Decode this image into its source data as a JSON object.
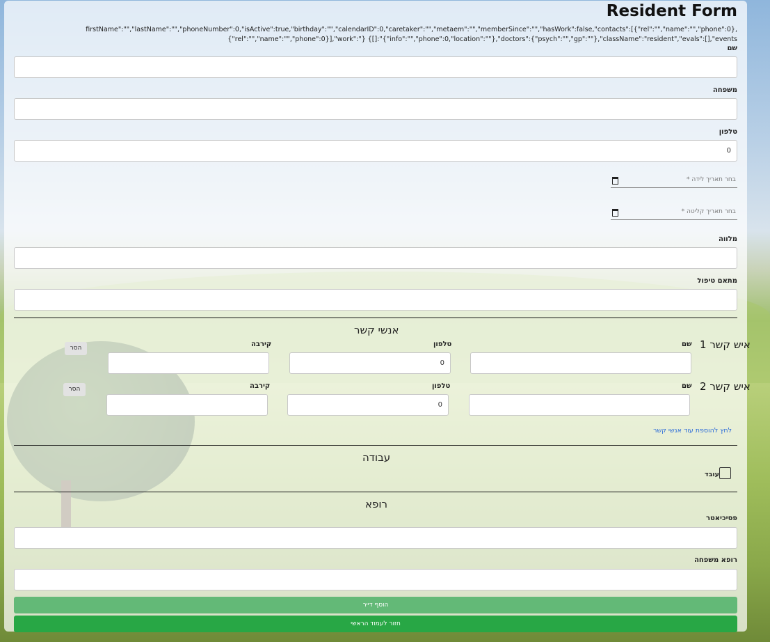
{
  "form": {
    "title": "Resident Form",
    "debug_json": "firstName\":\"\",\"lastName\":\"\",\"phoneNumber\":0,\"isActive\":true,\"birthday\":\"\",\"calendarID\":0,\"caretaker\":\"\",\"metaem\":\"\",\"memberSince\":\"\",\"hasWork\":false,\"contacts\":[{\"rel\":\"\",\"name\":\"\",\"phone\":0},{\"rel\":\"\",\"name\":\"\",\"phone\":0}],\"work\":\"} {[]:\"{\"info\":\"\",\"phone\":0,\"location\":\"\"},\"doctors\":{\"psych\":\"\",\"gp\":\"\"},\"className\":\"resident\",\"evals\":[],\"events",
    "first_name_label": "שם",
    "last_name_label": "משפחה",
    "phone_label": "טלפון",
    "phone_value": "0",
    "birthday_placeholder": "בחר תאריך לידה *",
    "member_since_placeholder": "בחר תאריך קליטה *",
    "caretaker_label": "מלווה",
    "metaem_label": "מתאם טיפול"
  },
  "contacts": {
    "section_title": "אנשי קשר",
    "name_label": "שם",
    "phone_label": "טלפון",
    "rel_label": "קירבה",
    "remove_label": "הסר",
    "items": [
      {
        "title": "איש קשר 1",
        "phone": "0"
      },
      {
        "title": "איש קשר 2",
        "phone": "0"
      }
    ],
    "add_link": "לחץ להוספת עוד אנשי קשר"
  },
  "work": {
    "section_title": "עבודה",
    "checkbox_label": "עובד",
    "checked": false
  },
  "doctors": {
    "section_title": "רופא",
    "psych_label": "פסיכיאטר",
    "gp_label": "רופא משפחה"
  },
  "actions": {
    "add_resident": "הוסף דייר",
    "back_home": "חזור לעמוד הראשי"
  },
  "colors": {
    "add_button": "#63b977",
    "back_button": "#28a745",
    "link": "#2a6bd8"
  }
}
